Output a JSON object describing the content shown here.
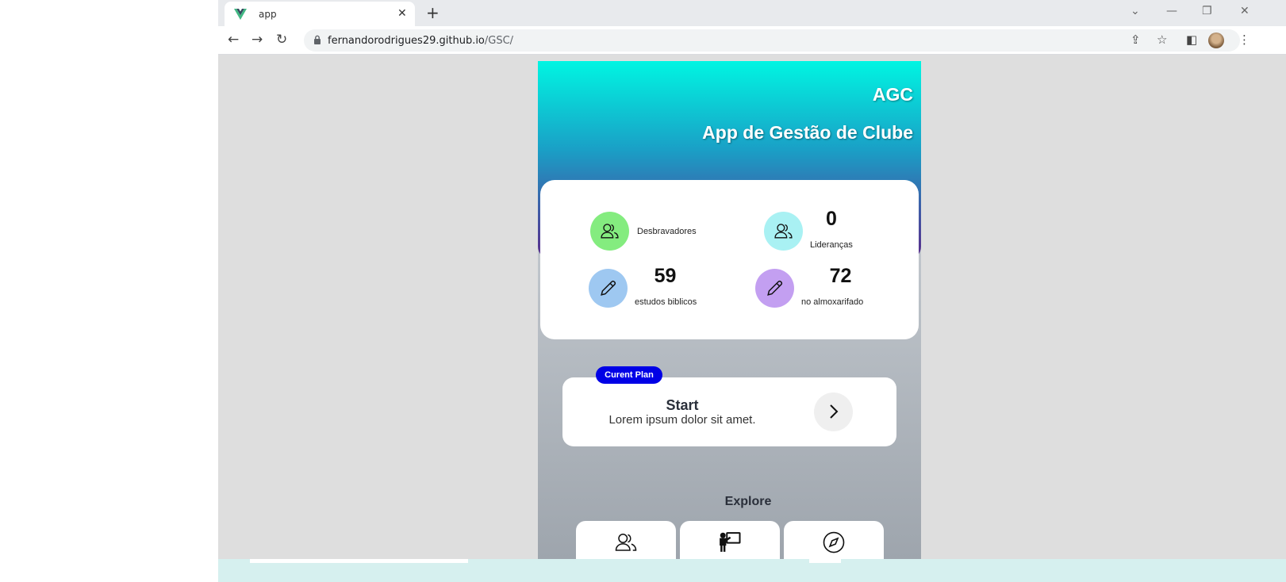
{
  "browser": {
    "tab_title": "app",
    "url_host": "fernandorodrigues29.github.io",
    "url_path": "/GSC/"
  },
  "hero": {
    "abbr": "AGC",
    "title": "App de Gestão de Clube"
  },
  "stats": [
    {
      "number": "",
      "label": "Desbravadores",
      "color": "#84ec7f",
      "icon": "users-icon"
    },
    {
      "number": "0",
      "label": "Lideranças",
      "color": "#a9f1f3",
      "icon": "users-icon"
    },
    {
      "number": "59",
      "label": "estudos biblicos",
      "color": "#9ec8f1",
      "icon": "pencil-icon"
    },
    {
      "number": "72",
      "label": "no almoxarifado",
      "color": "#c39ff1",
      "icon": "pencil-icon"
    }
  ],
  "plan": {
    "badge": "Curent Plan",
    "title": "Start",
    "description": "Lorem ipsum dolor sit amet."
  },
  "explore": {
    "title": "Explore",
    "items": [
      {
        "icon": "users-icon"
      },
      {
        "icon": "teacher-board-icon"
      },
      {
        "icon": "compass-icon"
      }
    ]
  }
}
